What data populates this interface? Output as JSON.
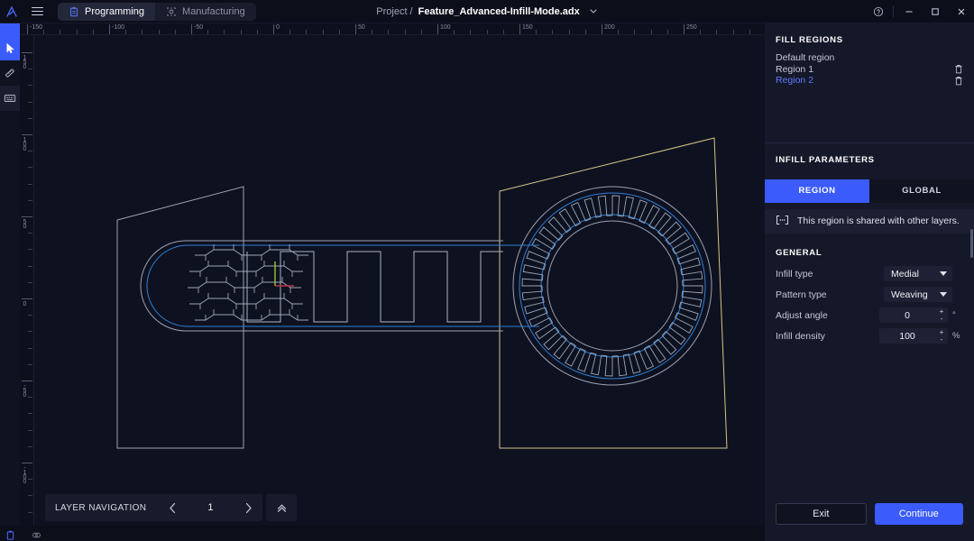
{
  "app": {
    "logo_icon": "lambda-logo-icon",
    "menu_icon": "hamburger-menu-icon"
  },
  "topbar": {
    "tabs": [
      {
        "label": "Programming",
        "icon": "clipboard-icon",
        "active": true
      },
      {
        "label": "Manufacturing",
        "icon": "target-gear-icon",
        "active": false
      }
    ],
    "project_label": "Project /",
    "project_name": "Feature_Advanced-Infill-Mode.adx",
    "project_chevron_icon": "chevron-down-icon",
    "window_controls": [
      {
        "name": "help-button",
        "icon": "question-circle-icon"
      },
      {
        "name": "minimize-button",
        "icon": "minimize-icon"
      },
      {
        "name": "maximize-button",
        "icon": "maximize-icon"
      },
      {
        "name": "close-button",
        "icon": "close-icon"
      }
    ]
  },
  "left_toolbar": {
    "tools": [
      {
        "name": "select-tool",
        "icon": "cursor-arrow-icon",
        "selected": true
      },
      {
        "name": "measure-tool",
        "icon": "ruler-pen-icon",
        "selected": false
      },
      {
        "name": "keyboard-tool",
        "icon": "keyboard-icon",
        "selected": false
      }
    ]
  },
  "rulers": {
    "horizontal": {
      "labels": [
        "-150",
        "-100",
        "-50",
        "0",
        "50",
        "100",
        "150",
        "200",
        "250"
      ],
      "unit_step": 50,
      "minor_per_major": 5
    },
    "vertical": {
      "labels": [
        "150",
        "100",
        "50",
        "0",
        "-50",
        "-100"
      ],
      "unit_step": 50,
      "minor_per_major": 5
    }
  },
  "canvas": {
    "background": "#0e1120",
    "origin_axes": {
      "x_axis_color": "#b5353f",
      "y_axis_color": "#9fc03a"
    },
    "colors": {
      "outline_gray": "#9aa2b4",
      "toolpath_blue": "#2f7fd4",
      "region_select_yellow": "#d7c489",
      "infill_line": "#9aa8b8"
    },
    "regions": [
      {
        "name": "left-region-outline",
        "shape": "quadrilateral",
        "color": "#9aa2b4"
      },
      {
        "name": "right-region-outline",
        "shape": "quadrilateral",
        "color": "#d7c489"
      }
    ],
    "infill_patterns": [
      {
        "name": "honeycomb-weave-infill",
        "location": "left-rounded-end"
      },
      {
        "name": "square-wave-infill",
        "location": "center-bar"
      },
      {
        "name": "castellated-ring-infill",
        "location": "right-annulus"
      }
    ]
  },
  "layer_navigation": {
    "title": "LAYER NAVIGATION",
    "prev_icon": "chevron-left-icon",
    "next_icon": "chevron-right-icon",
    "current_layer": "1",
    "collapse_icon": "double-chevron-up-icon"
  },
  "right_panel": {
    "fill_regions": {
      "title": "FILL REGIONS",
      "items": [
        {
          "label": "Default region",
          "active": false,
          "deletable": false
        },
        {
          "label": "Region 1",
          "active": false,
          "deletable": true
        },
        {
          "label": "Region 2",
          "active": true,
          "deletable": true
        }
      ],
      "delete_icon": "trash-icon"
    },
    "infill_parameters": {
      "title": "INFILL PARAMETERS",
      "tabs": [
        {
          "label": "REGION",
          "active": true
        },
        {
          "label": "GLOBAL",
          "active": false
        }
      ],
      "shared_note": "This region is shared with other layers.",
      "shared_icon": "shared-layers-icon",
      "general_title": "GENERAL",
      "fields": [
        {
          "label": "Infill type",
          "type": "select",
          "value": "Medial",
          "unit": ""
        },
        {
          "label": "Pattern type",
          "type": "select",
          "value": "Weaving",
          "unit": ""
        },
        {
          "label": "Adjust angle",
          "type": "stepper",
          "value": "0",
          "unit": "°"
        },
        {
          "label": "Infill density",
          "type": "stepper",
          "value": "100",
          "unit": "%"
        }
      ],
      "stepper_increment": "+",
      "stepper_decrement": "-"
    },
    "footer": {
      "exit_label": "Exit",
      "continue_label": "Continue"
    },
    "accent_color": "#3b5bfd"
  },
  "status_bar": {
    "icons": [
      {
        "name": "clipboard-status-icon"
      },
      {
        "name": "visibility-status-icon"
      }
    ]
  }
}
